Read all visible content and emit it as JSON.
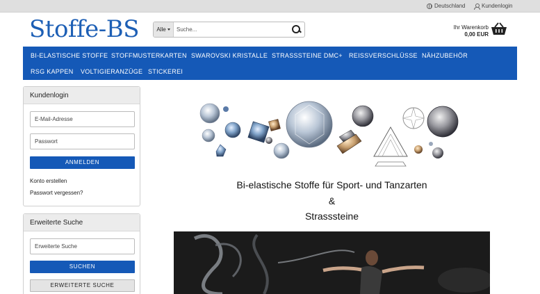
{
  "topbar": {
    "country": "Deutschland",
    "login": "Kundenlogin",
    "country_icon": "globe-icon",
    "login_icon": "user-icon"
  },
  "header": {
    "logo": "Stoffe-BS",
    "search_category": "Alle",
    "search_placeholder": "Suche...",
    "cart_label": "Ihr Warenkorb",
    "cart_total": "0,00 EUR",
    "cart_icon": "basket-icon"
  },
  "nav": {
    "items": [
      "BI-ELASTISCHE STOFFE",
      "STOFFMUSTERKARTEN",
      "SWAROVSKI KRISTALLE",
      "STRASSSTEINE DMC+",
      "REISSVERSCHLÜSSE",
      "NÄHZUBEHÖR",
      "RSG KAPPEN",
      "VOLTIGIERANZÜGE",
      "STICKEREI"
    ]
  },
  "login_box": {
    "title": "Kundenlogin",
    "email_placeholder": "E-Mail-Adresse",
    "password_placeholder": "Passwort",
    "submit": "ANMELDEN",
    "create_account": "Konto erstellen",
    "forgot_password": "Passwort vergessen?"
  },
  "search_box": {
    "title": "Erweiterte Suche",
    "placeholder": "Erweiterte Suche",
    "submit": "SUCHEN",
    "advanced": "ERWEITERTE SUCHE"
  },
  "main": {
    "headline_1": "Bi-elastische Stoffe für Sport- und Tanzarten",
    "headline_amp": "&",
    "headline_2": "Strasssteine"
  },
  "colors": {
    "brand_blue": "#1559b7",
    "logo_blue": "#1d5fb5",
    "topbar_grey": "#dfdfdf"
  }
}
